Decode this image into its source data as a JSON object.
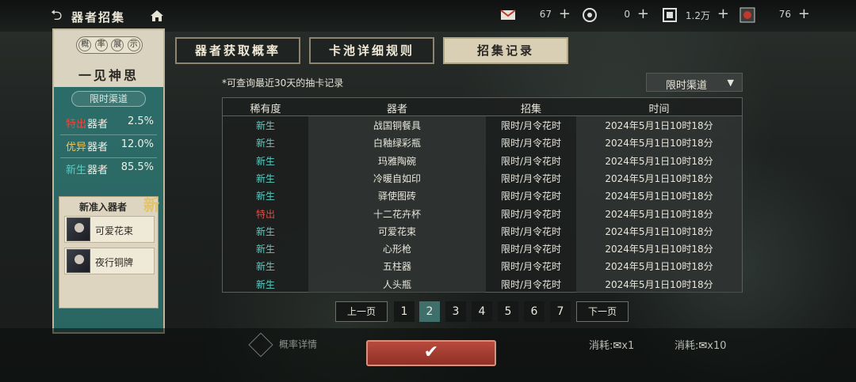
{
  "topbar": {
    "title": "器者招集",
    "resources": [
      {
        "icon": "ticket-icon",
        "value": "67"
      },
      {
        "icon": "coin-icon",
        "value": "0"
      },
      {
        "icon": "token-icon",
        "value": "1.2万"
      },
      {
        "icon": "gem-icon",
        "value": "76"
      }
    ]
  },
  "left_panel": {
    "tab_chars": [
      "概",
      "率",
      "展",
      "示"
    ],
    "title": "一见神思",
    "channel": "限时渠道",
    "rates": [
      {
        "tag": "特出",
        "label": "器者",
        "pct": "2.5%",
        "color": "#e64a3f"
      },
      {
        "tag": "优异",
        "label": "器者",
        "pct": "12.0%",
        "color": "#e7c56a"
      },
      {
        "tag": "新生",
        "label": "器者",
        "pct": "85.5%",
        "color": "#5fcbc0"
      }
    ],
    "new_title": "新准入器者",
    "new_badge": "新",
    "new_items": [
      "可爱花束",
      "夜行铜牌"
    ]
  },
  "tabs": [
    "器者获取概率",
    "卡池详细规则",
    "招集记录"
  ],
  "active_tab": 2,
  "note": "*可查询最近30天的抽卡记录",
  "filter": "限时渠道",
  "table": {
    "headers": [
      "稀有度",
      "器者",
      "招集",
      "时间"
    ],
    "rows": [
      {
        "rarity": "新生",
        "name": "战国铜餐具",
        "recruit": "限时/月令花时",
        "time": "2024年5月1日10时18分"
      },
      {
        "rarity": "新生",
        "name": "白釉绿彩瓶",
        "recruit": "限时/月令花时",
        "time": "2024年5月1日10时18分"
      },
      {
        "rarity": "新生",
        "name": "玛雅陶碗",
        "recruit": "限时/月令花时",
        "time": "2024年5月1日10时18分"
      },
      {
        "rarity": "新生",
        "name": "冷暖自如印",
        "recruit": "限时/月令花时",
        "time": "2024年5月1日10时18分"
      },
      {
        "rarity": "新生",
        "name": "驿使图砖",
        "recruit": "限时/月令花时",
        "time": "2024年5月1日10时18分"
      },
      {
        "rarity": "特出",
        "name": "十二花卉杯",
        "recruit": "限时/月令花时",
        "time": "2024年5月1日10时18分"
      },
      {
        "rarity": "新生",
        "name": "可爱花束",
        "recruit": "限时/月令花时",
        "time": "2024年5月1日10时18分"
      },
      {
        "rarity": "新生",
        "name": "心形枪",
        "recruit": "限时/月令花时",
        "time": "2024年5月1日10时18分"
      },
      {
        "rarity": "新生",
        "name": "五柱器",
        "recruit": "限时/月令花时",
        "time": "2024年5月1日10时18分"
      },
      {
        "rarity": "新生",
        "name": "人头瓶",
        "recruit": "限时/月令花时",
        "time": "2024年5月1日10时18分"
      }
    ]
  },
  "pagination": {
    "prev": "上一页",
    "next": "下一页",
    "pages": [
      "1",
      "2",
      "3",
      "4",
      "5",
      "6",
      "7"
    ],
    "current": "2"
  },
  "bottom": {
    "prob_detail": "概率详情",
    "cost_1": "消耗:",
    "cost_1_count": "x1",
    "cost_10": "消耗:",
    "cost_10_count": "x10",
    "confirm_icon": "check-icon"
  },
  "colors": {
    "rarity_new": "#5fcbc0",
    "rarity_special": "#e64a3f",
    "rarity_excellent": "#e7c56a",
    "panel_teal": "#2d6e6a",
    "confirm_red": "#b84a3d"
  }
}
